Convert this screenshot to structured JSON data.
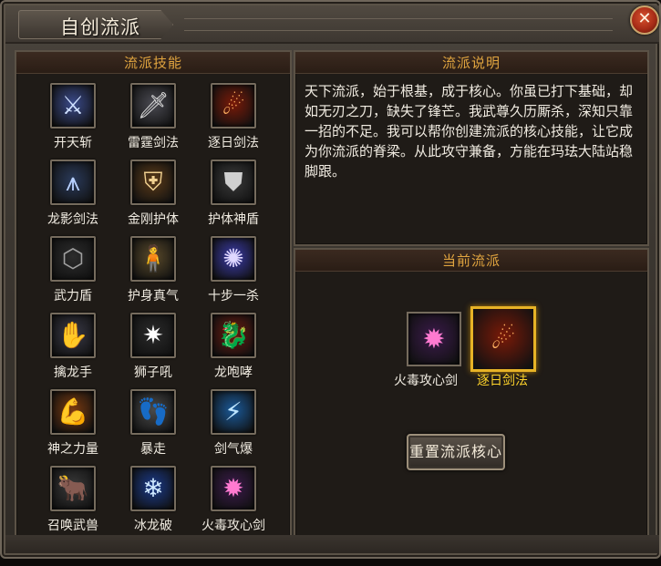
{
  "window": {
    "title": "自创流派",
    "close_label": "✕"
  },
  "skills_panel": {
    "header": "流派技能",
    "skills": [
      {
        "label": "开天斩",
        "icon": "sword-slash-icon",
        "bg": "#3a4a8a",
        "glyph": "⚔",
        "color": "#cfe0ff"
      },
      {
        "label": "雷霆剑法",
        "icon": "thunder-sword-icon",
        "bg": "#4a4a52",
        "glyph": "🗡",
        "color": "#e0e0e0"
      },
      {
        "label": "逐日剑法",
        "icon": "sun-chasing-sword-icon",
        "bg": "#7a1a08",
        "glyph": "☄",
        "color": "#ffb060"
      },
      {
        "label": "龙影剑法",
        "icon": "dragon-shadow-sword-icon",
        "bg": "#2a3a5a",
        "glyph": "⩚",
        "color": "#b8d0ff"
      },
      {
        "label": "金刚护体",
        "icon": "diamond-shield-icon",
        "bg": "#5a3a18",
        "glyph": "⛨",
        "color": "#f0d090"
      },
      {
        "label": "护体神盾",
        "icon": "divine-armor-icon",
        "bg": "#3a3a3a",
        "glyph": "⛊",
        "color": "#d0d0d0"
      },
      {
        "label": "武力盾",
        "icon": "force-shield-icon",
        "bg": "#2c2c2c",
        "glyph": "⬡",
        "color": "#a0a0a0"
      },
      {
        "label": "护身真气",
        "icon": "protective-qi-icon",
        "bg": "#5a4a2a",
        "glyph": "🧍",
        "color": "#f0e0b0"
      },
      {
        "label": "十步一杀",
        "icon": "ten-step-kill-icon",
        "bg": "#3a3aa8",
        "glyph": "✺",
        "color": "#e0d8ff"
      },
      {
        "label": "擒龙手",
        "icon": "dragon-grab-hand-icon",
        "bg": "#3a3a48",
        "glyph": "✋",
        "color": "#c8c8d8"
      },
      {
        "label": "狮子吼",
        "icon": "lion-roar-icon",
        "bg": "#2a2a2a",
        "glyph": "✷",
        "color": "#ffffff"
      },
      {
        "label": "龙咆哮",
        "icon": "dragon-roar-icon",
        "bg": "#6a1a10",
        "glyph": "🐉",
        "color": "#ff8a60"
      },
      {
        "label": "神之力量",
        "icon": "god-power-icon",
        "bg": "#7a3a10",
        "glyph": "💪",
        "color": "#ffb070"
      },
      {
        "label": "暴走",
        "icon": "rampage-icon",
        "bg": "#4a4a4a",
        "glyph": "👣",
        "color": "#e8e8e8"
      },
      {
        "label": "剑气爆",
        "icon": "sword-qi-burst-icon",
        "bg": "#1a5a9a",
        "glyph": "⚡",
        "color": "#bfe6ff"
      },
      {
        "label": "召唤武兽",
        "icon": "summon-beast-icon",
        "bg": "#3a3a3a",
        "glyph": "🐂",
        "color": "#d0c8c0"
      },
      {
        "label": "冰龙破",
        "icon": "ice-dragon-icon",
        "bg": "#1a3a8a",
        "glyph": "❄",
        "color": "#cfe8ff"
      },
      {
        "label": "火毒攻心剑",
        "icon": "fire-poison-sword-icon",
        "bg": "#3a1a4a",
        "glyph": "✹",
        "color": "#ff7ad0"
      }
    ]
  },
  "description_panel": {
    "header": "流派说明",
    "text": "天下流派，始于根基，成于核心。你虽已打下基础，却如无刃之刀，缺失了锋芒。我武尊久历厮杀，深知只靠一招的不足。我可以帮你创建流派的核心技能，让它成为你流派的脊梁。从此攻守兼备，方能在玛珐大陆站稳脚跟。"
  },
  "current_panel": {
    "header": "当前流派",
    "slots": [
      {
        "label": "火毒攻心剑",
        "icon": "fire-poison-sword-icon",
        "bg": "#3a1a4a",
        "glyph": "✹",
        "color": "#ff7ad0",
        "label_color": "#f1ece2",
        "active": false
      },
      {
        "label": "逐日剑法",
        "icon": "sun-chasing-sword-icon",
        "bg": "#7a1a08",
        "glyph": "☄",
        "color": "#ffb060",
        "label_color": "#ffd42a",
        "active": true
      }
    ],
    "reset_button": "重置流派核心"
  }
}
